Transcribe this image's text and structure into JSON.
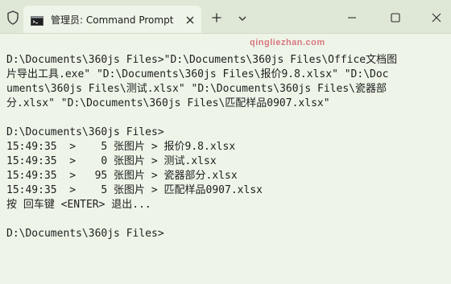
{
  "titlebar": {
    "tab_title": "管理员: Command Prompt",
    "icons": {
      "shield": "shield-icon",
      "cmd": "cmd-icon",
      "tab_close": "close-icon",
      "new_tab": "plus-icon",
      "dropdown": "chevron-down-icon",
      "minimize": "minimize-icon",
      "maximize": "maximize-icon",
      "close": "close-icon"
    }
  },
  "watermark": "qingliezhan.com",
  "console": {
    "lines": [
      "",
      "D:\\Documents\\360js Files>\"D:\\Documents\\360js Files\\Office文档图",
      "片导出工具.exe\" \"D:\\Documents\\360js Files\\报价9.8.xlsx\" \"D:\\Doc",
      "uments\\360js Files\\测试.xlsx\" \"D:\\Documents\\360js Files\\瓷器部",
      "分.xlsx\" \"D:\\Documents\\360js Files\\匹配样品0907.xlsx\"",
      "",
      "D:\\Documents\\360js Files>",
      "15:49:35  >    5 张图片 > 报价9.8.xlsx",
      "15:49:35  >    0 张图片 > 测试.xlsx",
      "15:49:35  >   95 张图片 > 瓷器部分.xlsx",
      "15:49:35  >    5 张图片 > 匹配样品0907.xlsx",
      "按 回车键 <ENTER> 退出...",
      "",
      "D:\\Documents\\360js Files>"
    ]
  },
  "colors": {
    "background": "#eef5e8",
    "titlebar": "#dfe7d6",
    "text": "#1e1e1e",
    "watermark": "#c8102e"
  }
}
